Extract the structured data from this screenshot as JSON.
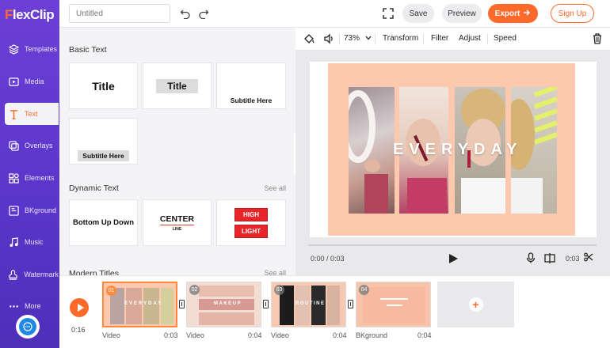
{
  "app": {
    "logo_f": "F",
    "logo_rest": "lexClip"
  },
  "sidebar": {
    "items": [
      {
        "label": "Templates",
        "icon": "layers-icon"
      },
      {
        "label": "Media",
        "icon": "media-icon"
      },
      {
        "label": "Text",
        "icon": "text-icon",
        "active": true
      },
      {
        "label": "Overlays",
        "icon": "overlays-icon"
      },
      {
        "label": "Elements",
        "icon": "elements-icon"
      },
      {
        "label": "BKground",
        "icon": "background-icon"
      },
      {
        "label": "Music",
        "icon": "music-icon"
      },
      {
        "label": "Watermark",
        "icon": "watermark-icon"
      },
      {
        "label": "More",
        "icon": "more-icon"
      }
    ]
  },
  "topbar": {
    "title_placeholder": "Untitled",
    "save": "Save",
    "preview": "Preview",
    "export": "Export",
    "signup": "Sign Up"
  },
  "panel": {
    "basic_text": "Basic Text",
    "dynamic_text": "Dynamic Text",
    "modern_titles": "Modern Titles",
    "see_all": "See all",
    "basic_cards": [
      "Title",
      "Title",
      "Subtitle Here",
      "Subtitle Here"
    ],
    "dynamic_cards": {
      "bottom_up": "Bottom Up Down",
      "center": "CENTER",
      "center_sub": "LINE",
      "highlight_1": "HIGH",
      "highlight_2": "LIGHT"
    }
  },
  "editbar": {
    "zoom": "73%",
    "transform": "Transform",
    "filter": "Filter",
    "adjust": "Adjust",
    "speed": "Speed"
  },
  "canvas": {
    "overlay_text": "EVERYDAY",
    "bg_color": "#fcc8ae"
  },
  "player": {
    "timecode": "0:00 / 0:03",
    "duration": "0:03"
  },
  "timeline": {
    "total": "0:16",
    "clips": [
      {
        "num": "01",
        "label": "Video",
        "dur": "0:03",
        "text": "EVERYDAY"
      },
      {
        "num": "02",
        "label": "Video",
        "dur": "0:04",
        "text": "MAKEUP"
      },
      {
        "num": "03",
        "label": "Video",
        "dur": "0:04",
        "text": "ROUTINE"
      },
      {
        "num": "04",
        "label": "BKground",
        "dur": "0:04",
        "text": ""
      }
    ]
  },
  "colors": {
    "accent": "#ff6a2b",
    "sidebar": "#5a35c9",
    "peach": "#fcc8ae"
  }
}
